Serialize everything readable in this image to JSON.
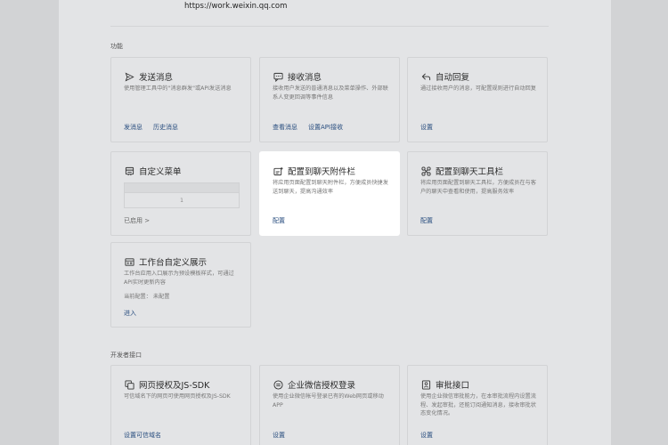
{
  "url": "https://work.weixin.qq.com",
  "sections": {
    "features_label": "功能",
    "developer_label": "开发者接口"
  },
  "cards": {
    "send_message": {
      "title": "发送消息",
      "desc": "使用管理工具中的\"消息群发\"或API发送消息",
      "links": [
        "发消息",
        "历史消息"
      ]
    },
    "receive_message": {
      "title": "接收消息",
      "desc": "接收用户发送的普通消息以及菜单操作、外部联系人变更回调等事件信息",
      "links": [
        "查看消息",
        "设置API接收"
      ]
    },
    "auto_reply": {
      "title": "自动回复",
      "desc": "通过接收用户的消息，可配置规则进行自动回复",
      "links": [
        "设置"
      ]
    },
    "custom_menu": {
      "title": "自定义菜单",
      "preview_number": "1",
      "enabled_label": "已启用 >"
    },
    "chat_attachment": {
      "title": "配置到聊天附件栏",
      "desc": "将应用页面配置到聊天附件栏，方便成员快捷发送到聊天，提高沟通效率",
      "links": [
        "配置"
      ]
    },
    "chat_toolbar": {
      "title": "配置到聊天工具栏",
      "desc": "将应用页面配置到聊天工具栏，方便成员在与客户的聊天中查看和使用，提高服务效率",
      "links": [
        "配置"
      ]
    },
    "workbench": {
      "title": "工作台自定义展示",
      "desc": "工作台应用入口展示为预设模板样式，可通过API实时更新内容",
      "status": "当前配置： 未配置",
      "links": [
        "进入"
      ]
    },
    "web_auth": {
      "title": "网页授权及JS-SDK",
      "desc": "可信域名下的网页可使用网页授权及JS-SDK",
      "links": [
        "设置可信域名"
      ]
    },
    "wecom_auth": {
      "title": "企业微信授权登录",
      "desc": "使用企业微信帐号登录已有的Web网页或移动APP",
      "links": [
        "设置"
      ]
    },
    "approval": {
      "title": "审批接口",
      "desc": "使用企业微信审批能力，在本审批流程内设置流程、发起审批，还能订阅通知消息，接收审批状态变化情况。",
      "links": [
        "设置"
      ]
    }
  },
  "colors": {
    "link": "#274c7e",
    "overlay_bg": "#d2d3d5",
    "page_bg": "#e3e4e6",
    "active_card": "#ffffff"
  }
}
